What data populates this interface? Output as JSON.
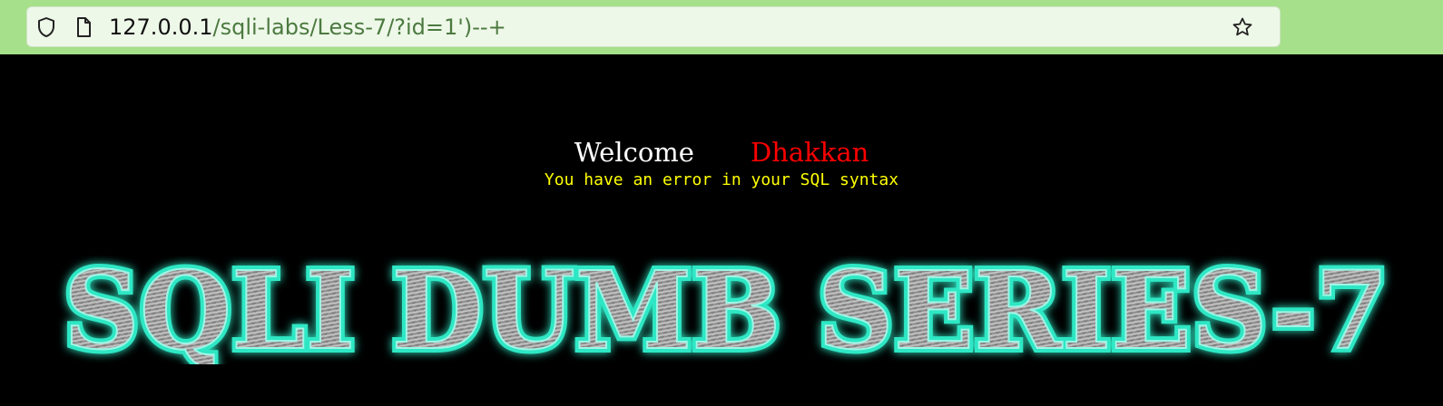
{
  "browser": {
    "url_host": "127.0.0.1",
    "url_path": "/sqli-labs/Less-7/?id=1')--+",
    "icons": [
      "shield-icon",
      "page-icon",
      "star-icon"
    ]
  },
  "page": {
    "welcome_text": "Welcome",
    "user_name": "Dhakkan",
    "message": "You have an error in your SQL syntax",
    "banner_text": "SQLI DUMB SERIES-7"
  },
  "colors": {
    "background": "#000000",
    "welcome": "#ffffff",
    "user_name": "#ff0000",
    "message": "#ffff00",
    "banner_glow": "#2de7c4",
    "banner_metal": "#9a9a9a",
    "browser_chrome": "#a6e08a"
  }
}
